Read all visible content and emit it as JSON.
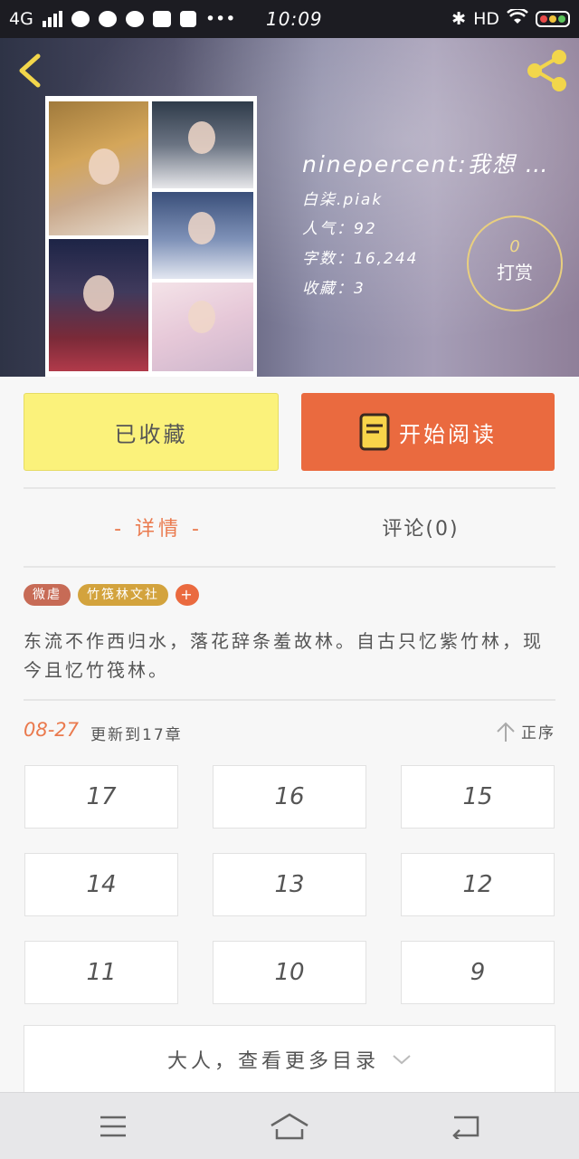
{
  "status_bar": {
    "network": "4G",
    "time": "10:09",
    "hd_label": "HD"
  },
  "book": {
    "title": "ninepercent:我想 …",
    "author_line": "白柒.piak",
    "popularity_line": "人气：92",
    "words_line": "字数：16,244",
    "favorites_line": "收藏：3"
  },
  "reward": {
    "count": "0",
    "label": "打赏"
  },
  "actions": {
    "favorited_label": "已收藏",
    "start_reading_label": "开始阅读"
  },
  "tabs": {
    "detail_label": "- 详情 -",
    "comments_label": "评论(0)"
  },
  "tags": [
    "微虐",
    "竹筏林文社",
    "+"
  ],
  "summary": "东流不作西归水，落花辞条羞故林。自古只忆紫竹林，现今且忆竹筏林。",
  "update": {
    "date": "08-27",
    "text": "更新到17章",
    "sort_label": "正序"
  },
  "chapters": [
    "17",
    "16",
    "15",
    "14",
    "13",
    "12",
    "11",
    "10",
    "9"
  ],
  "more_label": "大人，查看更多目录",
  "colors": {
    "accent": "#ea6a3f",
    "favorite_bg": "#fbf27b",
    "reward_ring": "#e9cf7e",
    "back_arrow": "#f2d64b",
    "share": "#f2d64b"
  }
}
